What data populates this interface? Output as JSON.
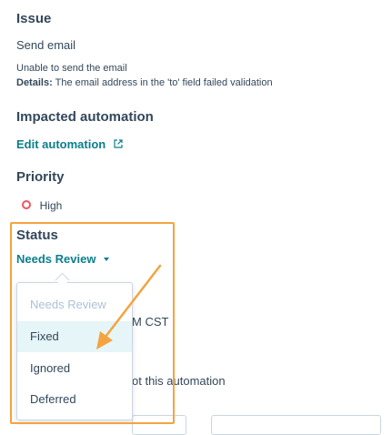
{
  "issue": {
    "heading": "Issue",
    "action": "Send email",
    "error": "Unable to send the email",
    "details_label": "Details:",
    "details_text": "The email address in the 'to' field failed validation"
  },
  "automation": {
    "heading": "Impacted automation",
    "link": "Edit automation"
  },
  "priority": {
    "heading": "Priority",
    "value": "High",
    "color": "#f2545b"
  },
  "status": {
    "heading": "Status",
    "current": "Needs Review",
    "options": [
      "Needs Review",
      "Fixed",
      "Ignored",
      "Deferred"
    ]
  },
  "background": {
    "time_fragment": "M CST",
    "automation_fragment": "ot this automation"
  },
  "colors": {
    "accent": "#0b7f8c",
    "annotation": "#f5a340",
    "text": "#33475b"
  },
  "icons": {
    "external_link": "external-link-icon",
    "caret": "caret-down-icon",
    "annotation_arrow": "arrow-annotation"
  }
}
